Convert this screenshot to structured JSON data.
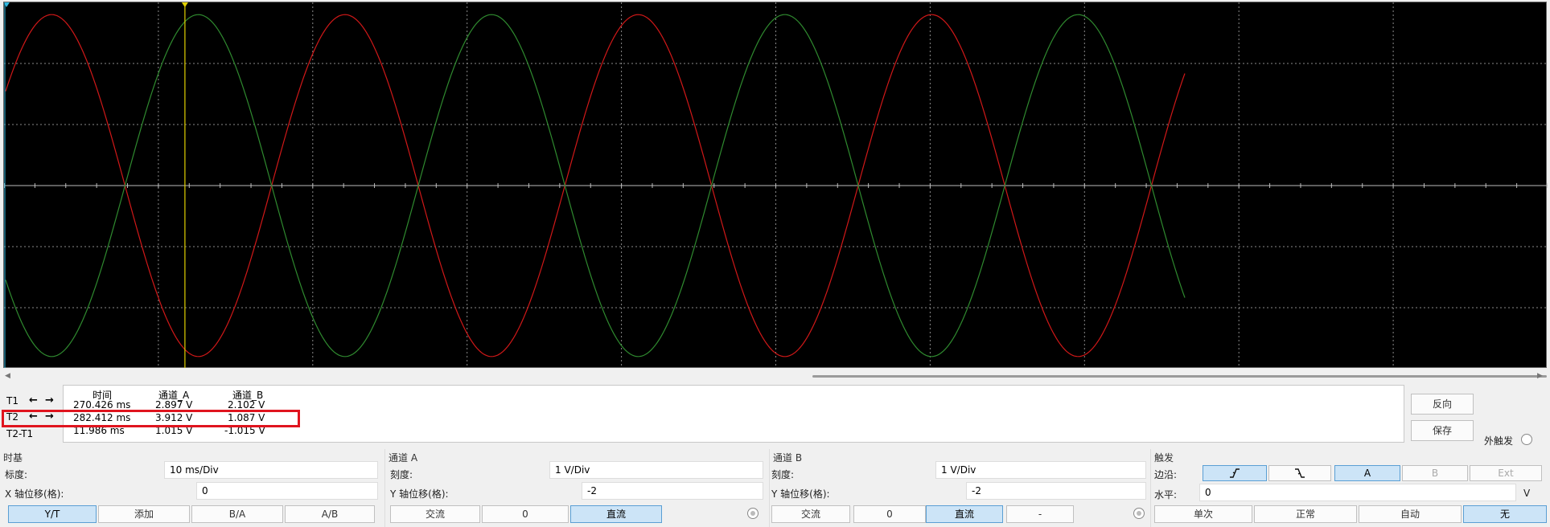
{
  "cursor_table": {
    "headers": [
      "时间",
      "通道_A",
      "通道_B"
    ],
    "rows": [
      {
        "name": "T1",
        "time": "270.426 ms",
        "a": "2.897 V",
        "b": "2.102 V"
      },
      {
        "name": "T2",
        "time": "282.412 ms",
        "a": "3.912 V",
        "b": "1.087 V"
      },
      {
        "name": "T2-T1",
        "time": "11.986 ms",
        "a": "1.015 V",
        "b": "-1.015 V"
      }
    ],
    "arrow_left": "←",
    "arrow_right": "→"
  },
  "side_buttons": {
    "reverse": "反向",
    "save": "保存",
    "ext_trigger": "外触发"
  },
  "timebase": {
    "title": "时基",
    "scale_label": "标度:",
    "scale_value": "10 ms/Div",
    "xpos_label": "X 轴位移(格):",
    "xpos_value": "0",
    "modes": [
      {
        "label": "Y/T",
        "active": true
      },
      {
        "label": "添加",
        "active": false
      },
      {
        "label": "B/A",
        "active": false
      },
      {
        "label": "A/B",
        "active": false
      }
    ]
  },
  "channel_a": {
    "title": "通道 A",
    "scale_label": "刻度:",
    "scale_value": "1  V/Div",
    "ypos_label": "Y 轴位移(格):",
    "ypos_value": "-2",
    "ac": "交流",
    "zero": "0",
    "dc": "直流"
  },
  "channel_b": {
    "title": "通道 B",
    "scale_label": "刻度:",
    "scale_value": "1  V/Div",
    "ypos_label": "Y 轴位移(格):",
    "ypos_value": "-2",
    "ac": "交流",
    "zero": "0",
    "dc": "直流",
    "dash": "-"
  },
  "trigger": {
    "title": "触发",
    "edge_label": "边沿:",
    "rising_icon": "rising-edge",
    "falling_icon": "falling-edge",
    "src_a": "A",
    "src_b": "B",
    "src_ext": "Ext",
    "level_label": "水平:",
    "level_value": "0",
    "level_unit": "V",
    "modes": [
      {
        "label": "单次",
        "active": false
      },
      {
        "label": "正常",
        "active": false
      },
      {
        "label": "自动",
        "active": false
      },
      {
        "label": "无",
        "active": true
      }
    ]
  },
  "scope": {
    "colors": {
      "background": "#000000",
      "grid": "#8a8a8a",
      "channel_a": "#d01818",
      "channel_b": "#2f8a2f",
      "cursor_t1": "#e0d000",
      "cursor_t2": "#30b8e0"
    }
  }
}
